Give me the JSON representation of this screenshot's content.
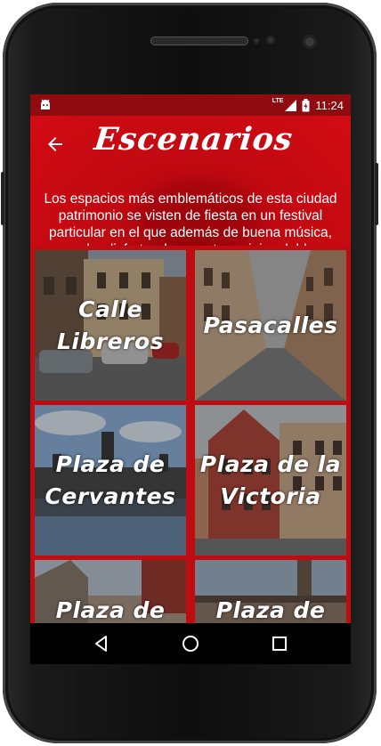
{
  "status_bar": {
    "network": "LTE",
    "time": "11:24"
  },
  "header": {
    "title": "Escenarios",
    "subtitle": "Los espacios más emblemáticos de esta ciudad patrimonio se visten de fiesta en un festival particular en el que además de buena música, poder disfrutar de un entorno inigualable"
  },
  "venues": [
    {
      "label": "Calle Libreros"
    },
    {
      "label": "Pasacalles"
    },
    {
      "label": "Plaza de\nCervantes"
    },
    {
      "label": "Plaza de la\nVictoria"
    },
    {
      "label": "Plaza de los"
    },
    {
      "label": "Plaza de los"
    }
  ],
  "colors": {
    "brand_red": "#c00911",
    "status_bar": "#8f0b10"
  },
  "icons": {
    "back": "arrow-left-icon",
    "nav_back": "triangle-back-icon",
    "nav_home": "circle-home-icon",
    "nav_recents": "square-recents-icon"
  }
}
